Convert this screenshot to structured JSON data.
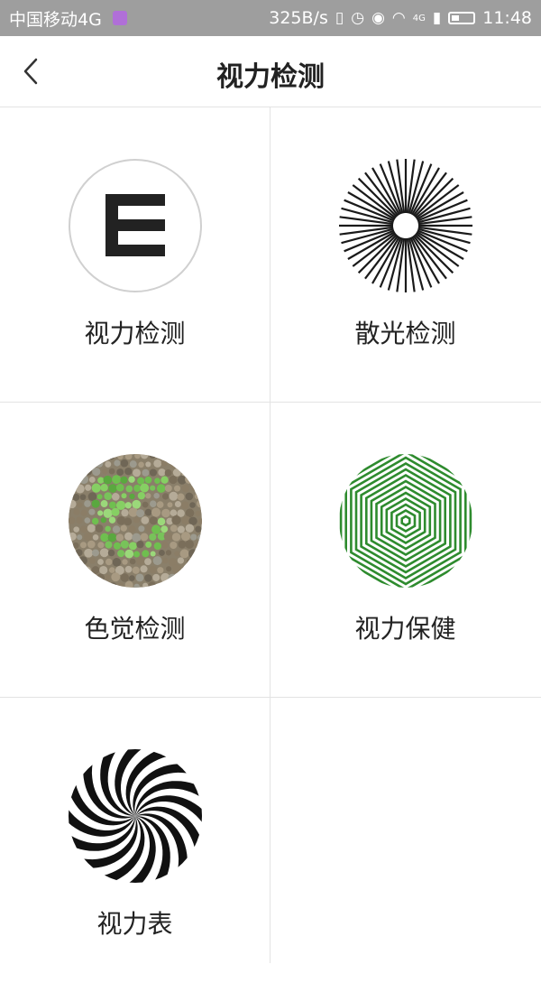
{
  "status_bar": {
    "carrier": "中国移动4G",
    "speed": "325B/s",
    "network": "4G",
    "time": "11:48"
  },
  "header": {
    "title": "视力检测"
  },
  "tiles": [
    {
      "label": "视力检测",
      "icon": "letter-e-icon"
    },
    {
      "label": "散光检测",
      "icon": "astigmatism-starburst-icon"
    },
    {
      "label": "色觉检测",
      "icon": "color-blind-plate-icon"
    },
    {
      "label": "视力保健",
      "icon": "green-hexagon-tunnel-icon"
    },
    {
      "label": "视力表",
      "icon": "black-white-spiral-icon"
    }
  ],
  "colors": {
    "title_text": "#222222",
    "divider": "#e3e3e3",
    "hexagon_green": "#2e8b2e"
  }
}
